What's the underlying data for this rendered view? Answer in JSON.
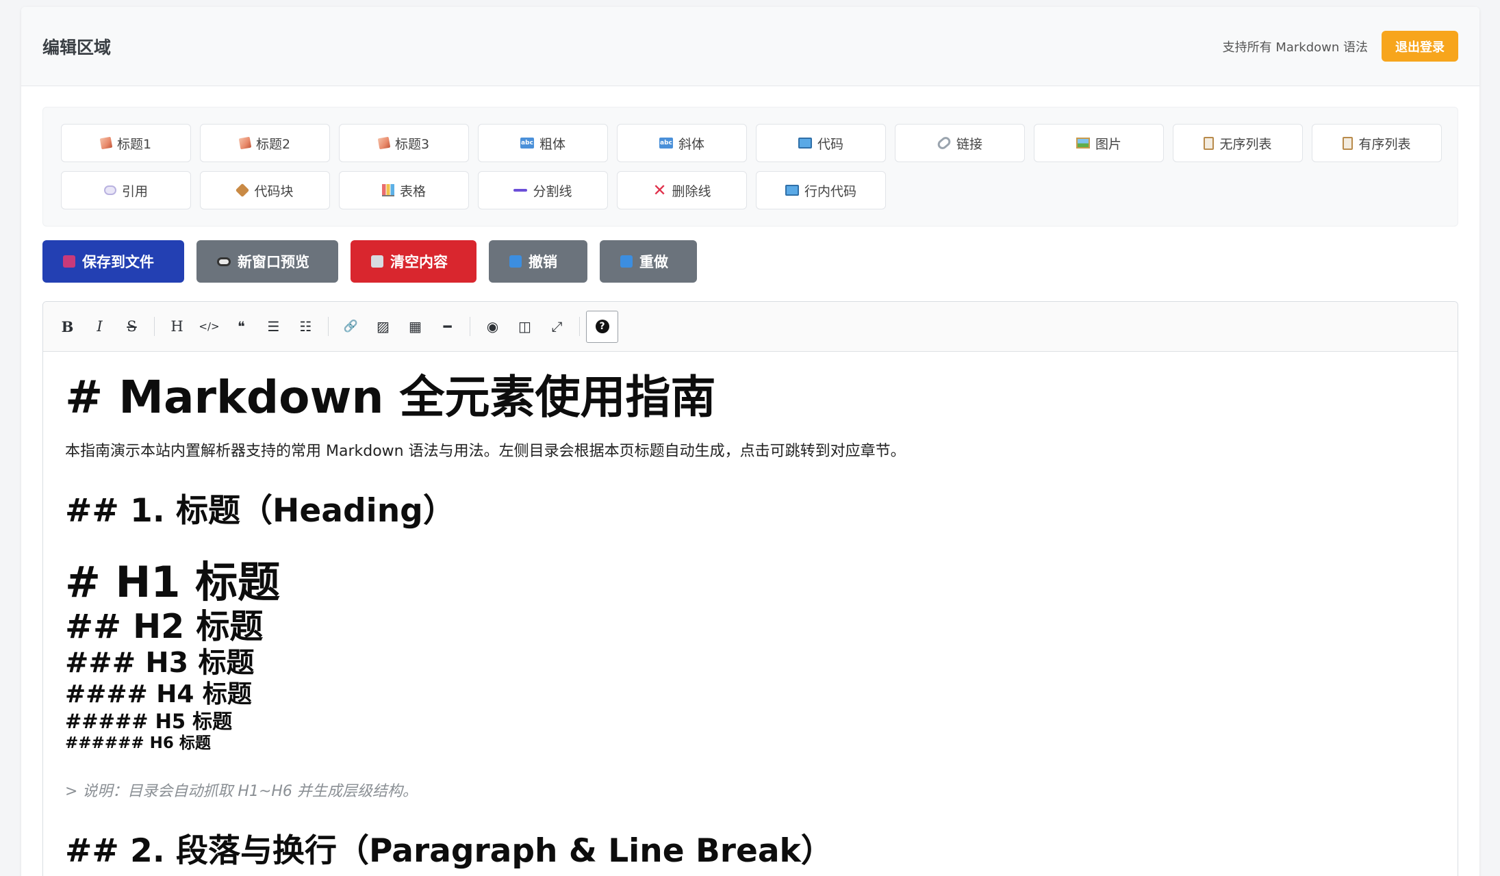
{
  "header": {
    "title": "编辑区域",
    "note": "支持所有 Markdown 语法",
    "logout_label": "退出登录",
    "logout_color": "#f7a51c"
  },
  "quick_insert": [
    {
      "label": "标题1",
      "icon": "pencil-icon"
    },
    {
      "label": "标题2",
      "icon": "pencil-icon"
    },
    {
      "label": "标题3",
      "icon": "pencil-icon"
    },
    {
      "label": "粗体",
      "icon": "abc-icon"
    },
    {
      "label": "斜体",
      "icon": "abc-icon"
    },
    {
      "label": "代码",
      "icon": "monitor-icon"
    },
    {
      "label": "链接",
      "icon": "link-icon"
    },
    {
      "label": "图片",
      "icon": "picture-icon"
    },
    {
      "label": "无序列表",
      "icon": "clipboard-icon"
    },
    {
      "label": "有序列表",
      "icon": "clipboard-icon"
    },
    {
      "label": "引用",
      "icon": "speech-bubble-icon"
    },
    {
      "label": "代码块",
      "icon": "package-icon"
    },
    {
      "label": "表格",
      "icon": "bar-chart-icon"
    },
    {
      "label": "分割线",
      "icon": "dash-icon"
    },
    {
      "label": "删除线",
      "icon": "cross-mark-icon"
    },
    {
      "label": "行内代码",
      "icon": "monitor-icon"
    }
  ],
  "actions": {
    "save": "保存到文件",
    "preview": "新窗口预览",
    "clear": "清空内容",
    "undo": "撤销",
    "redo": "重做",
    "colors": {
      "save": "#2340b3",
      "secondary": "#6b737c",
      "danger": "#d9262e"
    }
  },
  "toolbar": {
    "bold": "B",
    "italic": "I",
    "strike": "S",
    "heading": "H",
    "code": "</>",
    "quote": "❝",
    "ul": "☰",
    "ol": "☷",
    "link": "🔗",
    "image": "▨",
    "table": "▦",
    "hr": "━",
    "preview": "◉",
    "side_by_side": "◫",
    "fullscreen": "⤢",
    "help": "?"
  },
  "content": {
    "h1": "# Markdown 全元素使用指南",
    "intro": "本指南演示本站内置解析器支持的常用 Markdown 语法与用法。左侧目录会根据本页标题自动生成，点击可跳转到对应章节。",
    "section1": "## 1. 标题（Heading）",
    "ex_h1": "# H1 标题",
    "ex_h2": "## H2 标题",
    "ex_h3": "### H3 标题",
    "ex_h4": "#### H4 标题",
    "ex_h5": "##### H5 标题",
    "ex_h6": "###### H6 标题",
    "note": "> 说明：目录会自动抓取 H1~H6 并生成层级结构。",
    "section2": "## 2. 段落与换行（Paragraph & Line Break）"
  }
}
